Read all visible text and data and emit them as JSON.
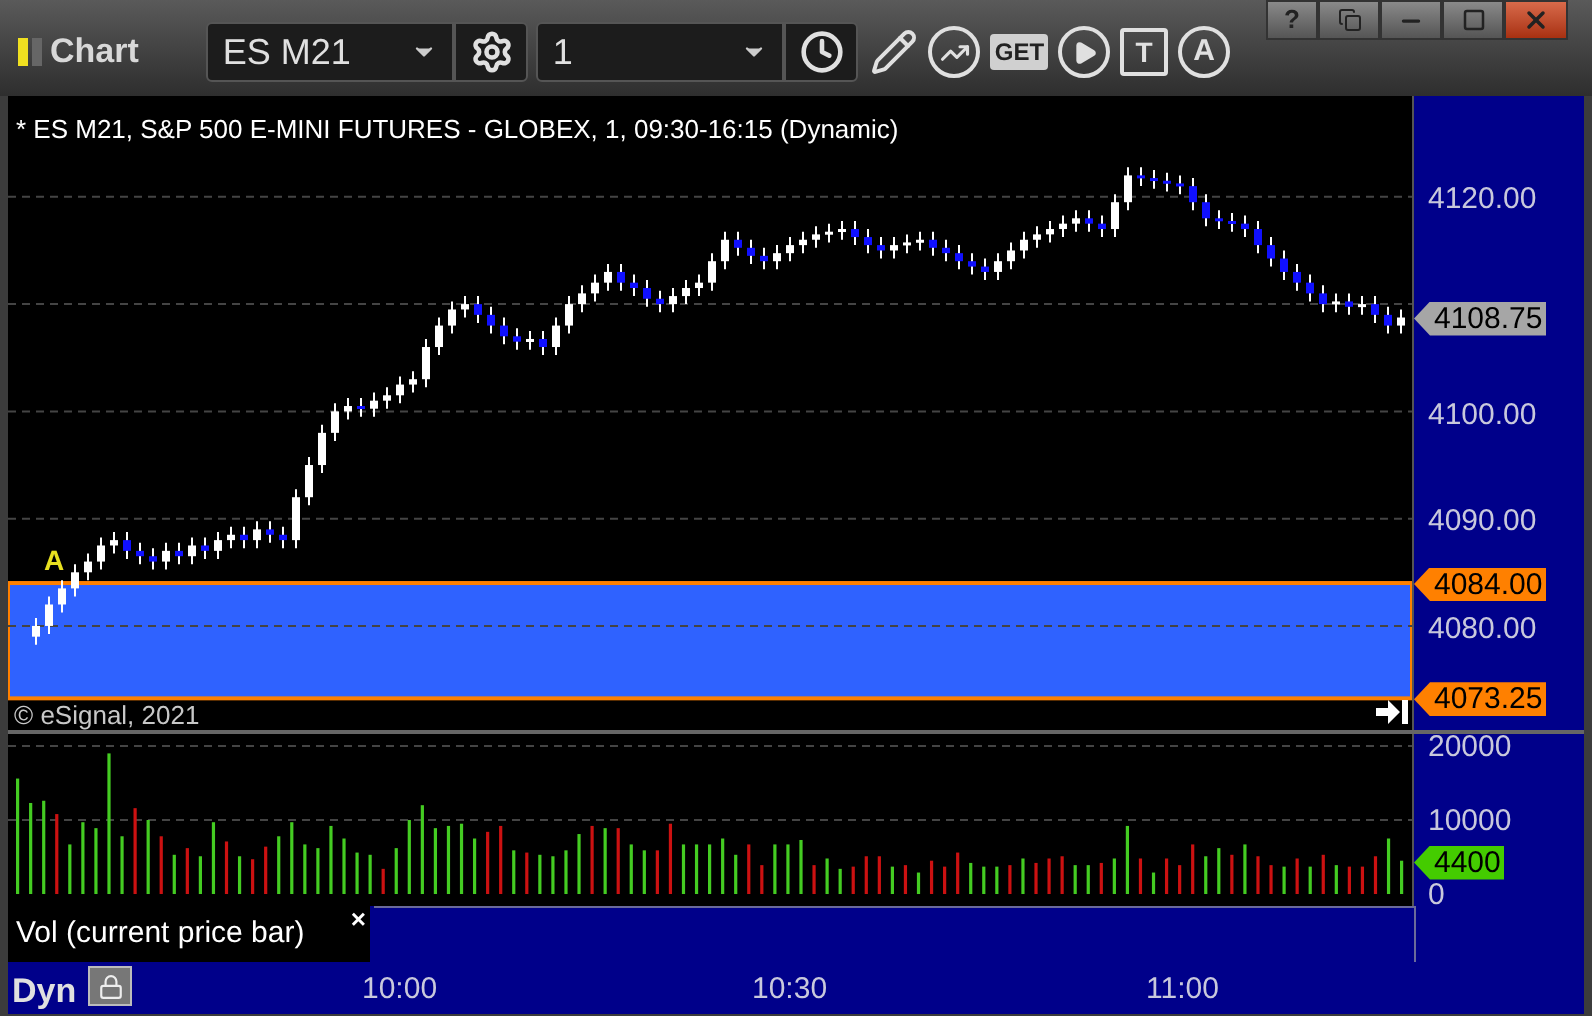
{
  "window": {
    "title": "Chart",
    "help": "?"
  },
  "toolbar": {
    "symbol": "ES M21",
    "interval": "1",
    "get_label": "GET",
    "text_tool_label": "T",
    "alert_label": "A"
  },
  "price_pane": {
    "header": "* ES M21, S&P 500 E-MINI FUTURES - GLOBEX, 1, 09:30-16:15 (Dynamic)",
    "copyright": "© eSignal, 2021",
    "signal_mark": "A",
    "markers": [
      {
        "label": "4108.75",
        "color": "#a6a6a6"
      },
      {
        "label": "4084.00",
        "color": "#ff8000"
      },
      {
        "label": "4073.25",
        "color": "#ff8000"
      }
    ],
    "chart_data": {
      "type": "candlestick",
      "grid": true,
      "ylim": [
        4070.3,
        4129.4
      ],
      "yticks": [
        {
          "value": 4120,
          "label": "4120.00"
        },
        {
          "value": 4100,
          "label": "4100.00"
        },
        {
          "value": 4090,
          "label": "4090.00"
        },
        {
          "value": 4080,
          "label": "4080.00"
        }
      ],
      "ohlc": [
        [
          4079,
          4080.75,
          4078.25,
          4080
        ],
        [
          4080,
          4082.75,
          4079.25,
          4082
        ],
        [
          4082,
          4084.25,
          4081.25,
          4083.5
        ],
        [
          4083.5,
          4085.75,
          4082.75,
          4085
        ],
        [
          4085,
          4086.75,
          4084.25,
          4086
        ],
        [
          4086,
          4088.25,
          4085.25,
          4087.5
        ],
        [
          4087.5,
          4088.75,
          4086.75,
          4088
        ],
        [
          4088,
          4088.75,
          4086.25,
          4087
        ],
        [
          4087,
          4087.75,
          4085.75,
          4086.5
        ],
        [
          4086.5,
          4087.25,
          4085.25,
          4086
        ],
        [
          4086,
          4087.75,
          4085.25,
          4087
        ],
        [
          4087,
          4087.75,
          4085.75,
          4086.5
        ],
        [
          4086.5,
          4088.25,
          4085.75,
          4087.5
        ],
        [
          4087.5,
          4088.25,
          4086.25,
          4087
        ],
        [
          4087,
          4088.75,
          4086.25,
          4088
        ],
        [
          4088,
          4089.25,
          4087.25,
          4088.5
        ],
        [
          4088.5,
          4089.25,
          4087.25,
          4088
        ],
        [
          4088,
          4089.75,
          4087.25,
          4089
        ],
        [
          4089,
          4089.75,
          4087.75,
          4088.5
        ],
        [
          4088.5,
          4089.25,
          4087.25,
          4088
        ],
        [
          4088,
          4092.75,
          4087.25,
          4092
        ],
        [
          4092,
          4095.75,
          4091.25,
          4095
        ],
        [
          4095,
          4098.75,
          4094.25,
          4098
        ],
        [
          4098,
          4100.75,
          4097.25,
          4100
        ],
        [
          4100,
          4101.25,
          4099.25,
          4100.5
        ],
        [
          4100.5,
          4101.25,
          4099.5,
          4100.25
        ],
        [
          4100.25,
          4101.75,
          4099.5,
          4101
        ],
        [
          4101,
          4102.25,
          4100.25,
          4101.5
        ],
        [
          4101.5,
          4103.25,
          4100.75,
          4102.5
        ],
        [
          4102.5,
          4103.75,
          4101.75,
          4103
        ],
        [
          4103,
          4106.75,
          4102.25,
          4106
        ],
        [
          4106,
          4108.75,
          4105.25,
          4108
        ],
        [
          4108,
          4110.25,
          4107.25,
          4109.5
        ],
        [
          4109.5,
          4110.75,
          4108.75,
          4110
        ],
        [
          4110,
          4110.75,
          4108.25,
          4109
        ],
        [
          4109,
          4109.75,
          4107.25,
          4108
        ],
        [
          4108,
          4108.75,
          4106.25,
          4107
        ],
        [
          4107,
          4107.75,
          4105.75,
          4106.5
        ],
        [
          4106.5,
          4107.5,
          4105.75,
          4106.75
        ],
        [
          4106.75,
          4107.5,
          4105.25,
          4106
        ],
        [
          4106,
          4108.75,
          4105.25,
          4108
        ],
        [
          4108,
          4110.75,
          4107.25,
          4110
        ],
        [
          4110,
          4111.75,
          4109.25,
          4111
        ],
        [
          4111,
          4112.75,
          4110.25,
          4112
        ],
        [
          4112,
          4113.75,
          4111.25,
          4113
        ],
        [
          4113,
          4113.75,
          4111.25,
          4112
        ],
        [
          4112,
          4112.75,
          4110.75,
          4111.5
        ],
        [
          4111.5,
          4112.25,
          4109.75,
          4110.5
        ],
        [
          4110.5,
          4111.25,
          4109.25,
          4110
        ],
        [
          4110,
          4111.5,
          4109.25,
          4110.75
        ],
        [
          4110.75,
          4112.25,
          4110,
          4111.5
        ],
        [
          4111.5,
          4112.75,
          4110.75,
          4112
        ],
        [
          4112,
          4114.75,
          4111.25,
          4114
        ],
        [
          4114,
          4116.75,
          4113.25,
          4116
        ],
        [
          4116,
          4116.75,
          4114.5,
          4115.25
        ],
        [
          4115.25,
          4116,
          4113.75,
          4114.5
        ],
        [
          4114.5,
          4115.25,
          4113.25,
          4114
        ],
        [
          4114,
          4115.5,
          4113.25,
          4114.75
        ],
        [
          4114.75,
          4116.25,
          4114,
          4115.5
        ],
        [
          4115.5,
          4116.75,
          4114.75,
          4116
        ],
        [
          4116,
          4117.25,
          4115.25,
          4116.5
        ],
        [
          4116.5,
          4117.5,
          4115.75,
          4116.75
        ],
        [
          4116.75,
          4117.75,
          4116,
          4117
        ],
        [
          4117,
          4117.75,
          4115.5,
          4116.25
        ],
        [
          4116.25,
          4117,
          4114.75,
          4115.5
        ],
        [
          4115.5,
          4116.25,
          4114.25,
          4115
        ],
        [
          4115,
          4116.25,
          4114.25,
          4115.5
        ],
        [
          4115.5,
          4116.5,
          4114.75,
          4115.75
        ],
        [
          4115.75,
          4116.75,
          4115,
          4116
        ],
        [
          4116,
          4116.75,
          4114.5,
          4115.25
        ],
        [
          4115.25,
          4116,
          4114,
          4114.75
        ],
        [
          4114.75,
          4115.5,
          4113.25,
          4114
        ],
        [
          4114,
          4114.75,
          4112.75,
          4113.5
        ],
        [
          4113.5,
          4114.25,
          4112.25,
          4113
        ],
        [
          4113,
          4114.75,
          4112.25,
          4114
        ],
        [
          4114,
          4115.75,
          4113.25,
          4115
        ],
        [
          4115,
          4116.75,
          4114.25,
          4116
        ],
        [
          4116,
          4117.25,
          4115.25,
          4116.5
        ],
        [
          4116.5,
          4117.75,
          4115.75,
          4117
        ],
        [
          4117,
          4118.25,
          4116.25,
          4117.5
        ],
        [
          4117.5,
          4118.75,
          4116.75,
          4118
        ],
        [
          4118,
          4118.75,
          4116.75,
          4117.5
        ],
        [
          4117.5,
          4118.25,
          4116.25,
          4117
        ],
        [
          4117,
          4120.25,
          4116.25,
          4119.5
        ],
        [
          4119.5,
          4122.75,
          4118.75,
          4122
        ],
        [
          4122,
          4122.75,
          4121,
          4121.75
        ],
        [
          4121.75,
          4122.5,
          4120.75,
          4121.5
        ],
        [
          4121.5,
          4122.25,
          4120.5,
          4121.25
        ],
        [
          4121.25,
          4122,
          4120.25,
          4121
        ],
        [
          4121,
          4121.75,
          4118.75,
          4119.5
        ],
        [
          4119.5,
          4120.25,
          4117.25,
          4118
        ],
        [
          4118,
          4118.75,
          4117,
          4117.75
        ],
        [
          4117.75,
          4118.5,
          4116.75,
          4117.5
        ],
        [
          4117.5,
          4118.25,
          4116.25,
          4117
        ],
        [
          4117,
          4117.75,
          4114.75,
          4115.5
        ],
        [
          4115.5,
          4116.25,
          4113.5,
          4114.25
        ],
        [
          4114.25,
          4115,
          4112.25,
          4113
        ],
        [
          4113,
          4113.75,
          4111.25,
          4112
        ],
        [
          4112,
          4112.75,
          4110.25,
          4111
        ],
        [
          4111,
          4111.75,
          4109.25,
          4110
        ],
        [
          4110,
          4111,
          4109.25,
          4110.25
        ],
        [
          4110.25,
          4111,
          4109,
          4109.75
        ],
        [
          4109.75,
          4110.75,
          4109,
          4110
        ],
        [
          4110,
          4110.75,
          4108.25,
          4109
        ],
        [
          4109,
          4109.75,
          4107.25,
          4108
        ],
        [
          4108,
          4109.5,
          4107.25,
          4108.75
        ]
      ]
    }
  },
  "volume_pane": {
    "current": {
      "label": "4400",
      "color": "#44cc00"
    },
    "chart_data": {
      "type": "bar",
      "grid": true,
      "ylim": [
        -1620,
        21620
      ],
      "yticks": [
        {
          "value": 0,
          "label": "0"
        },
        {
          "value": 10000,
          "label": "10000"
        },
        {
          "value": 20000,
          "label": "20000"
        }
      ],
      "series": [
        {
          "color": "#44cc22",
          "values": [
            15600,
            12300,
            12600,
            null,
            6700,
            9700,
            8900,
            19000,
            7800,
            null,
            10000,
            null,
            5300,
            null,
            5100,
            9700,
            null,
            5100,
            null,
            null,
            7800,
            9700,
            6700,
            6200,
            9200,
            7500,
            5600,
            5300,
            null,
            6200,
            10000,
            12000,
            8900,
            9200,
            9500,
            7500,
            null,
            null,
            5900,
            null,
            5300,
            5100,
            5900,
            8100,
            null,
            8900,
            null,
            6700,
            5900,
            null,
            null,
            6700,
            6700,
            6700,
            7500,
            5300,
            null,
            null,
            6700,
            6700,
            7300,
            null,
            4800,
            3400,
            null,
            null,
            null,
            3700,
            null,
            2900,
            null,
            null,
            null,
            4200,
            3700,
            3700,
            null,
            4800,
            null,
            null,
            null,
            3900,
            3900,
            null,
            4800,
            9200,
            null,
            2900,
            null,
            null,
            null,
            5100,
            6200,
            null,
            6700,
            null,
            null,
            3700,
            null,
            3700,
            null,
            3900,
            null,
            null,
            null,
            7500,
            4500
          ]
        },
        {
          "color": "#cc1111",
          "values": [
            null,
            null,
            null,
            10800,
            null,
            null,
            null,
            null,
            null,
            11600,
            null,
            7800,
            null,
            6200,
            null,
            null,
            7100,
            null,
            4700,
            6400,
            null,
            null,
            null,
            null,
            null,
            null,
            null,
            null,
            3400,
            null,
            null,
            null,
            null,
            null,
            null,
            null,
            8400,
            9200,
            null,
            5600,
            null,
            null,
            null,
            null,
            9200,
            null,
            8900,
            null,
            null,
            5900,
            9500,
            null,
            null,
            null,
            null,
            null,
            6700,
            3900,
            null,
            null,
            null,
            3900,
            null,
            null,
            3700,
            5100,
            5100,
            null,
            3900,
            null,
            4500,
            3700,
            5600,
            null,
            null,
            null,
            3900,
            null,
            4200,
            4800,
            5100,
            null,
            null,
            4200,
            null,
            null,
            4800,
            null,
            4800,
            3900,
            6700,
            null,
            null,
            5300,
            null,
            5100,
            3900,
            null,
            4800,
            null,
            5300,
            null,
            3700,
            3700,
            5100,
            null,
            null
          ]
        }
      ]
    }
  },
  "study": {
    "label": "Vol (current price bar)",
    "close": "×"
  },
  "time_axis": {
    "mode": "Dyn",
    "ticks": [
      "10:00",
      "10:30",
      "11:00"
    ]
  }
}
